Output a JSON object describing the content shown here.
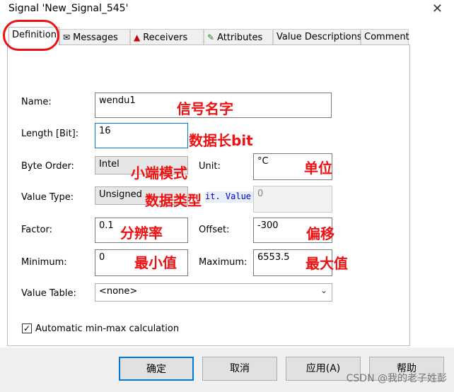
{
  "window": {
    "title": "Signal 'New_Signal_545'",
    "close_glyph": "✕"
  },
  "tabs": [
    {
      "label": "Definition",
      "icon": ""
    },
    {
      "label": "Messages",
      "icon": "envelope-icon"
    },
    {
      "label": "Receivers",
      "icon": "receiver-icon"
    },
    {
      "label": "Attributes",
      "icon": "pencil-icon"
    },
    {
      "label": "Value Descriptions",
      "icon": ""
    },
    {
      "label": "Comment",
      "icon": ""
    }
  ],
  "form": {
    "name_label": "Name:",
    "name_value": "wendu1",
    "length_label": "Length [Bit]:",
    "length_value": "16",
    "byte_order_label": "Byte Order:",
    "byte_order_value": "Intel",
    "unit_label": "Unit:",
    "unit_value": "°C",
    "value_type_label": "Value Type:",
    "value_type_value": "Unsigned",
    "value_type_hidden": "it. Value",
    "init_value": "0",
    "factor_label": "Factor:",
    "factor_value": "0.1",
    "offset_label": "Offset:",
    "offset_value": "-300",
    "minimum_label": "Minimum:",
    "minimum_value": "0",
    "maximum_label": "Maximum:",
    "maximum_value": "6553.5",
    "value_table_label": "Value Table:",
    "value_table_value": "<none>",
    "auto_minmax_label": "Automatic min-max calculation",
    "auto_minmax_checked": true
  },
  "annotations": {
    "name": "信号名字",
    "length": "数据长bit",
    "byte_order": "小端模式",
    "unit": "单位",
    "value_type": "数据类型",
    "factor": "分辨率",
    "offset": "偏移",
    "minimum": "最小值",
    "maximum": "最大值"
  },
  "buttons": {
    "ok": "确定",
    "cancel": "取消",
    "apply": "应用(A)",
    "help": "帮助"
  },
  "watermark": "CSDN @我的老子姓彭",
  "colors": {
    "annotation": "#ee1111",
    "focus": "#0078d7"
  }
}
